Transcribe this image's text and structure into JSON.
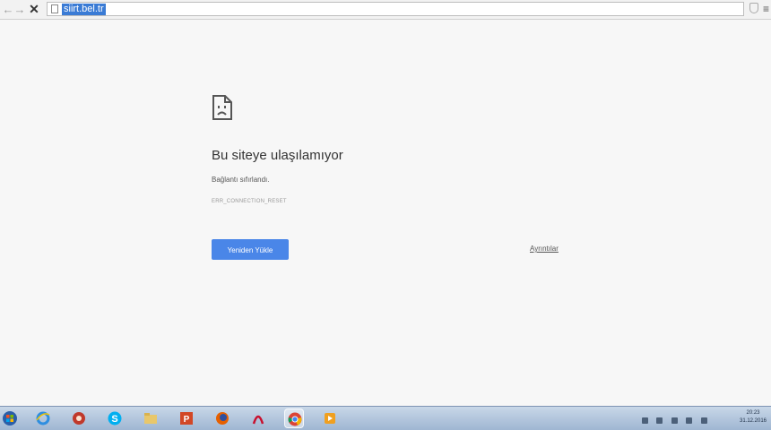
{
  "browser": {
    "url": "siirt.bel.tr",
    "back_icon": "back-arrow-icon",
    "forward_icon": "forward-arrow-icon",
    "stop_icon": "stop-icon",
    "star_icon": "bookmark-star-icon",
    "menu_icon": "chrome-menu-icon"
  },
  "error_page": {
    "icon": "sad-page-icon",
    "title": "Bu siteye ulaşılamıyor",
    "description": "Bağlantı sıfırlandı.",
    "error_code": "ERR_CONNECTION_RESET",
    "reload_label": "Yeniden Yükle",
    "details_label": "Ayrıntılar",
    "accent_color": "#4a86e8"
  },
  "taskbar": {
    "items": [
      {
        "icon": "windows-start-icon"
      },
      {
        "icon": "internet-explorer-icon"
      },
      {
        "icon": "media-app-icon"
      },
      {
        "icon": "skype-icon"
      },
      {
        "icon": "file-explorer-icon"
      },
      {
        "icon": "powerpoint-icon"
      },
      {
        "icon": "firefox-icon"
      },
      {
        "icon": "adobe-reader-icon"
      },
      {
        "icon": "chrome-icon"
      },
      {
        "icon": "media-player-icon"
      }
    ],
    "clock_time": "20:23",
    "clock_date": "31.12.2016"
  }
}
